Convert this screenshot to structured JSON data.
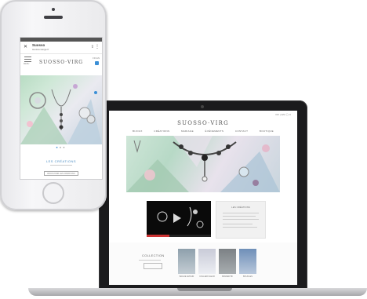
{
  "laptop_site": {
    "logo": "SUOSSO·VIRG",
    "toplinks": "FR | EN   ◯ 0",
    "nav": [
      "BIJOUX",
      "CRÉATIONS",
      "MARIAGE",
      "ÉVÉNEMENTS",
      "CONTACT",
      "BOUTIQUE"
    ],
    "panel_title": "LES CRÉATIONS",
    "collection_title": "COLLECTION",
    "thumb_captions": [
      "BAGUE AMOUR",
      "COLLIER FLEUR",
      "PENDENTIF",
      "BOUCLES"
    ]
  },
  "phone": {
    "browser_title": "Suosso",
    "browser_url": "suosso-vierge.fr",
    "menu_label": "MENU",
    "logo": "SUOSSO·VIRG",
    "header_icons": "FR EN",
    "carousel_dots": [
      "●",
      "●",
      "●"
    ],
    "creations_label": "LES CRÉATIONS",
    "cta_label": "DÉCOUVRIR LES CRÉATIONS"
  },
  "colors": {
    "accent": "#3b8fd6",
    "screen_bezel": "#1b1b1d"
  },
  "video_progress": 0.35
}
